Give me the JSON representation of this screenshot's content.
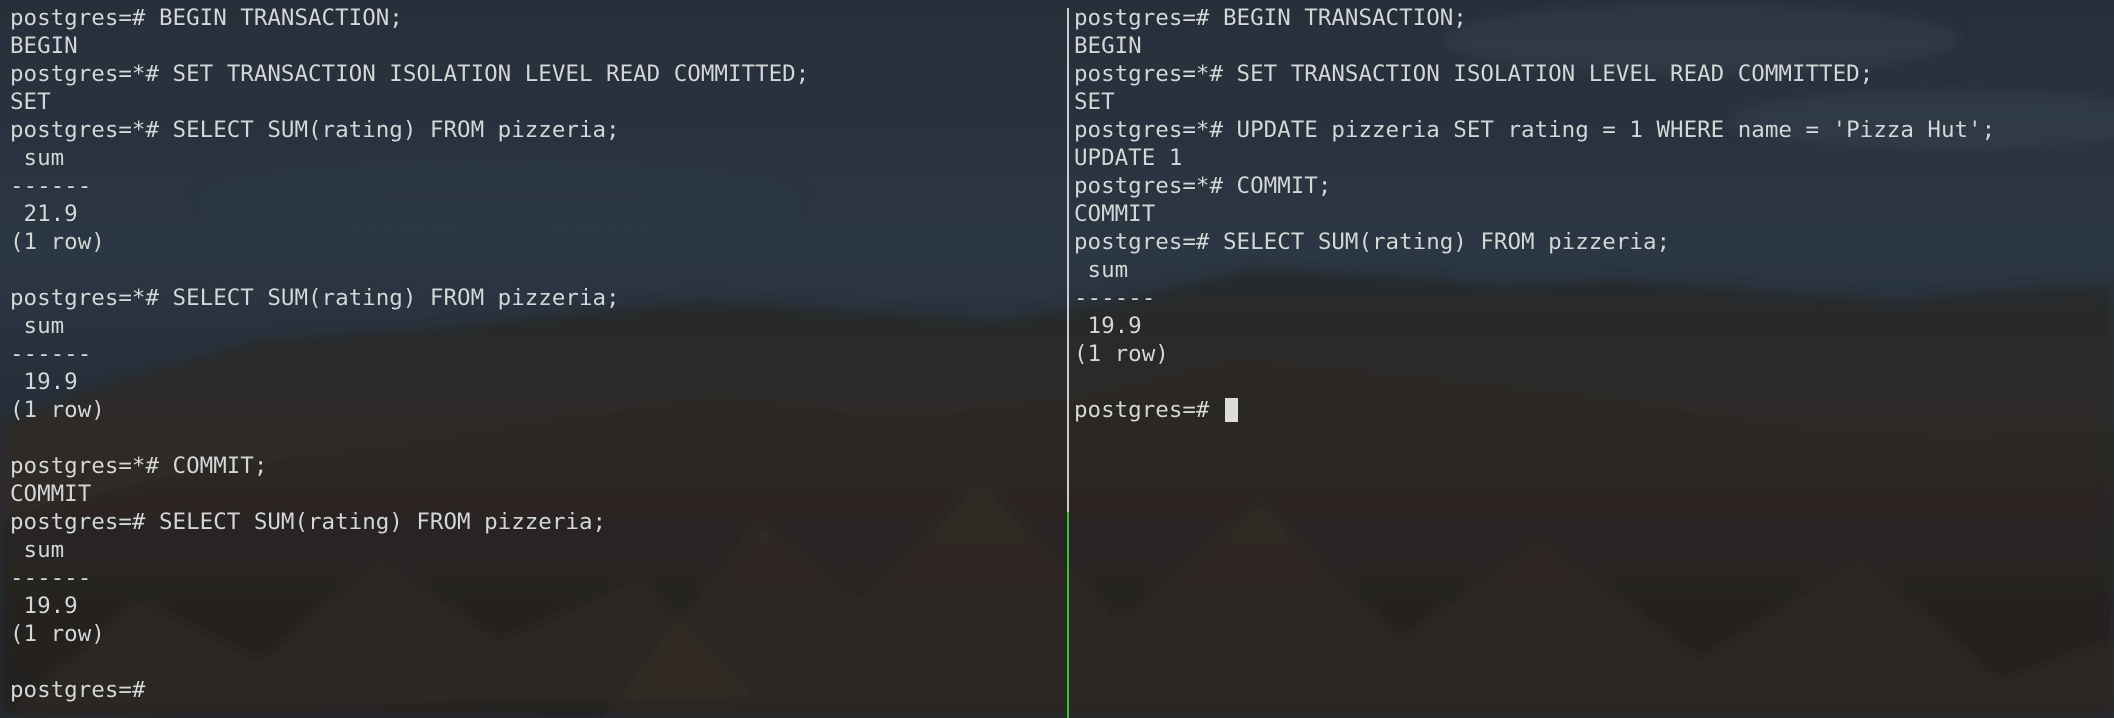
{
  "background": {
    "icon": "blurred-mountain-wallpaper",
    "sky_color": "#2e3b4c",
    "mountain_color": "#3a2f26"
  },
  "colors": {
    "text": "#d4d7d8",
    "divider": "#c9ccce",
    "active_divider": "#3bbf3a",
    "cursor": "#dcdcdc"
  },
  "left_pane": {
    "lines": [
      "postgres=# BEGIN TRANSACTION;",
      "BEGIN",
      "postgres=*# SET TRANSACTION ISOLATION LEVEL READ COMMITTED;",
      "SET",
      "postgres=*# SELECT SUM(rating) FROM pizzeria;",
      " sum",
      "------",
      " 21.9",
      "(1 row)",
      "",
      "postgres=*# SELECT SUM(rating) FROM pizzeria;",
      " sum",
      "------",
      " 19.9",
      "(1 row)",
      "",
      "postgres=*# COMMIT;",
      "COMMIT",
      "postgres=# SELECT SUM(rating) FROM pizzeria;",
      " sum",
      "------",
      " 19.9",
      "(1 row)",
      "",
      "postgres=#"
    ]
  },
  "right_pane": {
    "lines": [
      "postgres=# BEGIN TRANSACTION;",
      "BEGIN",
      "postgres=*# SET TRANSACTION ISOLATION LEVEL READ COMMITTED;",
      "SET",
      "postgres=*# UPDATE pizzeria SET rating = 1 WHERE name = 'Pizza Hut';",
      "UPDATE 1",
      "postgres=*# COMMIT;",
      "COMMIT",
      "postgres=# SELECT SUM(rating) FROM pizzeria;",
      " sum",
      "------",
      " 19.9",
      "(1 row)",
      "",
      "postgres=# "
    ]
  }
}
